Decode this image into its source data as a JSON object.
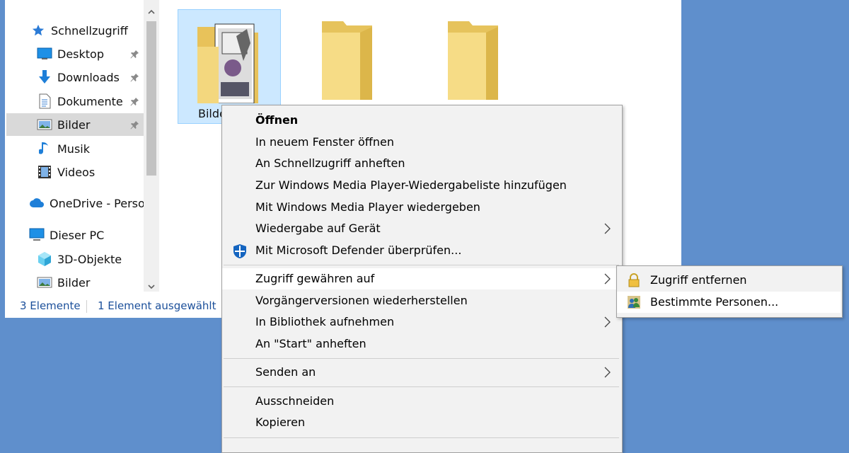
{
  "nav": {
    "items": [
      {
        "label": "Schnellzugriff",
        "icon": "star-icon"
      },
      {
        "label": "Desktop",
        "icon": "desktop-icon",
        "pinned": true
      },
      {
        "label": "Downloads",
        "icon": "download-arrow-icon",
        "pinned": true
      },
      {
        "label": "Dokumente",
        "icon": "document-icon",
        "pinned": true
      },
      {
        "label": "Bilder",
        "icon": "pictures-icon",
        "pinned": true,
        "selected": true
      },
      {
        "label": "Musik",
        "icon": "music-note-icon"
      },
      {
        "label": "Videos",
        "icon": "film-icon"
      },
      {
        "label": "OneDrive - Persor",
        "icon": "cloud-icon"
      },
      {
        "label": "Dieser PC",
        "icon": "computer-icon"
      },
      {
        "label": "3D-Objekte",
        "icon": "cube-icon"
      },
      {
        "label": "Bilder",
        "icon": "pictures-icon"
      }
    ]
  },
  "content": {
    "selected_folder_label": "Bilde"
  },
  "status": {
    "count": "3 Elemente",
    "selection": "1 Element ausgewählt"
  },
  "context_menu": {
    "items": [
      {
        "label": "Öffnen",
        "bold": true
      },
      {
        "label": "In neuem Fenster öffnen"
      },
      {
        "label": "An Schnellzugriff anheften"
      },
      {
        "label": "Zur Windows Media Player-Wiedergabeliste hinzufügen"
      },
      {
        "label": "Mit Windows Media Player wiedergeben"
      },
      {
        "label": "Wiedergabe auf Gerät",
        "submenu": true
      },
      {
        "label": "Mit Microsoft Defender überprüfen...",
        "icon": "defender-shield-icon"
      },
      {
        "label": "Zugriff gewähren auf",
        "submenu": true,
        "highlighted": true
      },
      {
        "label": "Vorgängerversionen wiederherstellen"
      },
      {
        "label": "In Bibliothek aufnehmen",
        "submenu": true
      },
      {
        "label": "An \"Start\" anheften"
      },
      {
        "label": "Senden an",
        "submenu": true
      },
      {
        "label": "Ausschneiden"
      },
      {
        "label": "Kopieren"
      }
    ]
  },
  "submenu": {
    "items": [
      {
        "label": "Zugriff entfernen",
        "icon": "lock-icon"
      },
      {
        "label": "Bestimmte Personen...",
        "icon": "people-icon",
        "highlighted": true
      }
    ]
  },
  "colors": {
    "desktop_background": "#5f8fcc",
    "selection_blue": "#cce8ff",
    "status_text": "#1b4f9a"
  }
}
